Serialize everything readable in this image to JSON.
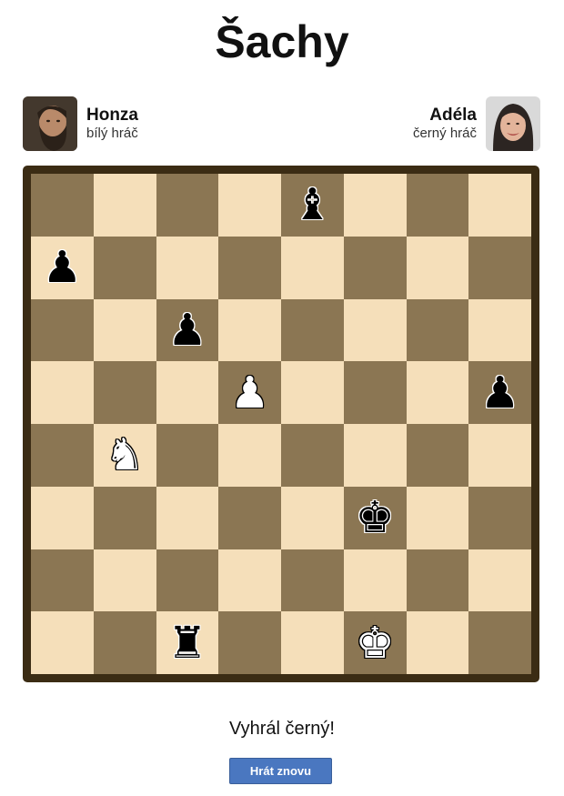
{
  "title": "Šachy",
  "players": {
    "white": {
      "name": "Honza",
      "role": "bílý hráč"
    },
    "black": {
      "name": "Adéla",
      "role": "černý hráč"
    }
  },
  "colors": {
    "light_square": "#f5dfba",
    "dark_square": "#8b7653",
    "frame": "#3b2c14",
    "button": "#4a77c0"
  },
  "board": {
    "orientation": "white at bottom",
    "pieces": [
      {
        "square": "e8",
        "type": "bishop",
        "color": "black",
        "icon": "black-bishop-icon"
      },
      {
        "square": "a7",
        "type": "pawn",
        "color": "black",
        "icon": "black-pawn-icon"
      },
      {
        "square": "c6",
        "type": "pawn",
        "color": "black",
        "icon": "black-pawn-icon"
      },
      {
        "square": "d5",
        "type": "pawn",
        "color": "white",
        "icon": "white-pawn-icon"
      },
      {
        "square": "h5",
        "type": "pawn",
        "color": "black",
        "icon": "black-pawn-icon"
      },
      {
        "square": "b4",
        "type": "knight",
        "color": "white",
        "icon": "white-knight-icon"
      },
      {
        "square": "f3",
        "type": "king",
        "color": "black",
        "icon": "black-king-icon"
      },
      {
        "square": "c1",
        "type": "rook",
        "color": "black",
        "icon": "black-rook-icon"
      },
      {
        "square": "f1",
        "type": "king",
        "color": "white",
        "icon": "white-king-icon"
      }
    ]
  },
  "status": "Vyhrál černý!",
  "button_label": "Hrát znovu"
}
